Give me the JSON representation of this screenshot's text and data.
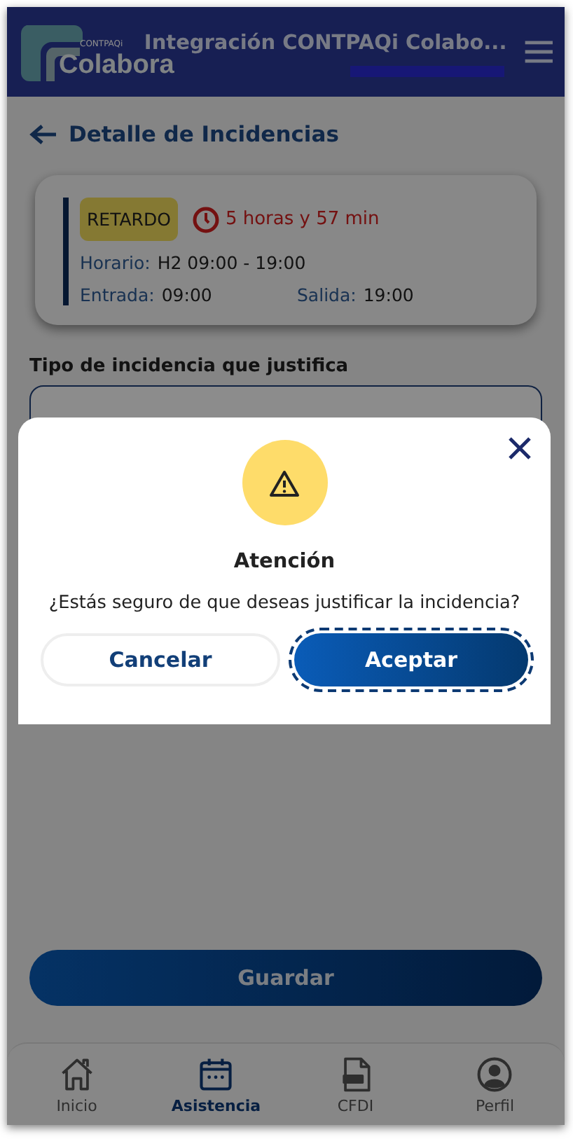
{
  "header": {
    "logo": {
      "brand": "CONTPAQi",
      "name": "Colabora"
    },
    "title": "Integración CONTPAQi Colabo..."
  },
  "page_title": "Detalle de Incidencias",
  "card": {
    "badge": "RETARDO",
    "duration": "5 horas y 57 min",
    "schedule_label": "Horario:",
    "schedule": "H2 09:00 - 19:00",
    "entry_label": "Entrada:",
    "entry": "09:00",
    "exit_label": "Salida:",
    "exit": "19:00"
  },
  "field": {
    "label": "Tipo de incidencia que justifica"
  },
  "save_button": "Guardar",
  "nav": [
    {
      "label": "Inicio",
      "kind": "home",
      "selected": false
    },
    {
      "label": "Asistencia",
      "kind": "calendar",
      "selected": true
    },
    {
      "label": "CFDI",
      "kind": "pdf",
      "selected": false
    },
    {
      "label": "Perfil",
      "kind": "profile",
      "selected": false
    }
  ],
  "dialog": {
    "title": "Atención",
    "message": "¿Estás seguro de que deseas justificar la incidencia?",
    "buttons": [
      {
        "label": "Cancelar",
        "kind": "secondary",
        "focused": false
      },
      {
        "label": "Aceptar",
        "kind": "primary",
        "focused": true
      }
    ]
  }
}
